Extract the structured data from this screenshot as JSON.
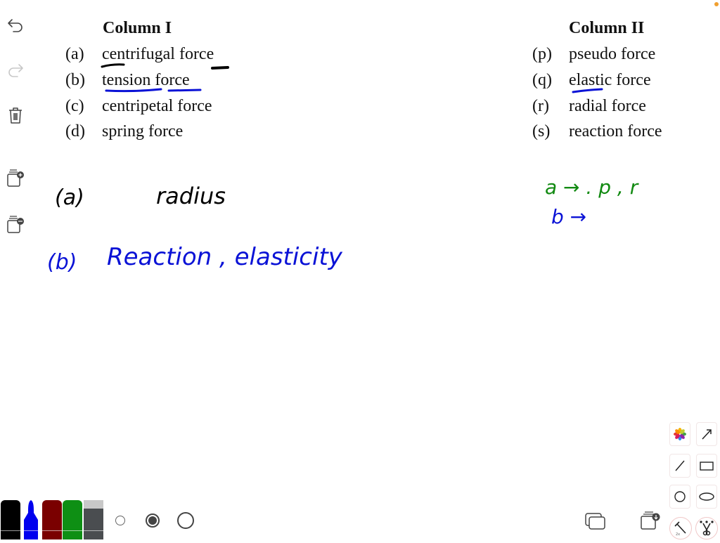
{
  "left_toolbar": {
    "items": [
      {
        "name": "undo",
        "icon": "undo-icon",
        "enabled": true
      },
      {
        "name": "redo",
        "icon": "redo-icon",
        "enabled": false
      },
      {
        "name": "delete",
        "icon": "trash-icon",
        "enabled": true
      },
      {
        "name": "add-page",
        "icon": "add-page-icon",
        "enabled": true
      },
      {
        "name": "page-options",
        "icon": "page-options-icon",
        "enabled": true
      }
    ]
  },
  "question": {
    "column1": {
      "heading": "Column I",
      "items": [
        {
          "label": "(a)",
          "text": "centrifugal force"
        },
        {
          "label": "(b)",
          "text": "tension force"
        },
        {
          "label": "(c)",
          "text": "centripetal force"
        },
        {
          "label": "(d)",
          "text": "spring force"
        }
      ]
    },
    "column2": {
      "heading": "Column II",
      "items": [
        {
          "label": "(p)",
          "text": "pseudo force"
        },
        {
          "label": "(q)",
          "text": "elastic force"
        },
        {
          "label": "(r)",
          "text": "radial force"
        },
        {
          "label": "(s)",
          "text": "reaction force"
        }
      ]
    }
  },
  "annotations": {
    "line_a_label": "(a)",
    "line_a_text": "radius",
    "line_b_label": "(b)",
    "line_b_text": "Reaction , elasticity",
    "answer_a": "a → . p , r",
    "answer_b": "b →"
  },
  "colors": {
    "ink_black": "#000000",
    "ink_blue": "#0a12d6",
    "ink_green": "#128a12",
    "marker_black": "#000000",
    "marker_blue": "#0000ee",
    "marker_darkred": "#7a0000",
    "marker_green": "#0e8f14",
    "marker_gray": "#4a4d50",
    "status_dot": "#f0a030"
  },
  "bottom_toolbar": {
    "markers": [
      "black",
      "blue",
      "dark-red",
      "green",
      "gray"
    ],
    "selected_marker": "blue",
    "sizes": [
      "small",
      "medium",
      "large"
    ],
    "selected_size": "medium"
  },
  "shape_tools": [
    "photos",
    "arrow",
    "line",
    "rectangle",
    "circle",
    "ellipse"
  ],
  "bottom_right": [
    "duplicate-page",
    "download-page",
    "laser-pointer",
    "cut-tool"
  ]
}
